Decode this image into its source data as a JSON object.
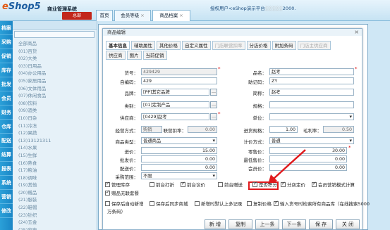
{
  "app": {
    "logo_prefix": "e",
    "logo_main": "Shop5",
    "subtitle": "商业管理系统",
    "hq_button": "总部",
    "auth_text": "授权用户<eShop演示平台",
    "auth_tail": "2000."
  },
  "top_tabs": [
    {
      "label": "首页"
    },
    {
      "label": "会员等级"
    },
    {
      "label": "商品档案"
    }
  ],
  "left_nav": [
    "档案",
    "采购",
    "促销",
    "库存",
    "批发",
    "会员",
    "财务",
    "仓库",
    "配送",
    "结算",
    "报表",
    "系统",
    "营销",
    "修改"
  ],
  "tree": {
    "items": [
      "全部商品",
      "(01)百货",
      "(02)大类",
      "(03)日用品",
      "(04)办公用品",
      "(05)家居用品",
      "(06)文体用品",
      "(07)休闲食品",
      "(08)饮料",
      "(09)酒类",
      "(10)日杂",
      "(11)冷冻",
      "(12)果蔬",
      "(13)13121311",
      "(14)水果",
      "(15)生鲜",
      "(16)熟食",
      "(17)粮油",
      "(18)调味",
      "(19)其他",
      "(20)赠品",
      "(21)服装",
      "(22)鞋帽",
      "(23)针织",
      "(24)五金",
      "(25)家电"
    ]
  },
  "dialog": {
    "title": "商品编辑",
    "tabs_row1": [
      {
        "label": "基本信息",
        "state": "active"
      },
      {
        "label": "辅助属性",
        "state": "normal"
      },
      {
        "label": "其他价格",
        "state": "normal"
      },
      {
        "label": "自定义属性",
        "state": "normal"
      },
      {
        "label": "门店联营扣率",
        "state": "disabled"
      },
      {
        "label": "分店价格",
        "state": "normal"
      },
      {
        "label": "附加条码",
        "state": "normal"
      },
      {
        "label": "门店主供应商",
        "state": "disabled"
      }
    ],
    "tabs_row2": [
      {
        "label": "供应商"
      },
      {
        "label": "图片"
      },
      {
        "label": "当前促销"
      }
    ],
    "fields": {
      "item_no": {
        "label": "货号：",
        "value": "429429"
      },
      "item_code": {
        "label": "自编码：",
        "value": "429"
      },
      "brand": {
        "label": "品牌：",
        "value": "[PP]其它品牌"
      },
      "category": {
        "label": "类别：",
        "value": "[01]定制产品"
      },
      "supplier": {
        "label": "供应商：",
        "value": "[0429]赵考"
      },
      "name": {
        "label": "品名：",
        "value": "赵考"
      },
      "mnemonic": {
        "label": "助记码：",
        "value": "ZY"
      },
      "short_name": {
        "label": "简称：",
        "value": "赵考"
      },
      "spec": {
        "label": "规格：",
        "value": ""
      },
      "unit": {
        "label": "单位：",
        "value": ""
      },
      "biz_mode": {
        "label": "经营方式：",
        "value": "购销"
      },
      "joint_rate": {
        "label": "联营扣率：",
        "value": "0.00"
      },
      "in_spec": {
        "label": "进货规格：",
        "value": "1.00"
      },
      "gross_rate": {
        "label": "毛利率：",
        "value": "0.50"
      },
      "item_type": {
        "label": "商品类型：",
        "value": "普通商品"
      },
      "price_type": {
        "label": "计价方式：",
        "value": "普通"
      },
      "purchase_price": {
        "label": "进价：",
        "value": "15.00"
      },
      "retail_price": {
        "label": "零售价：",
        "value": "30.00"
      },
      "wholesale_price": {
        "label": "批发价：",
        "value": "0.00"
      },
      "min_price": {
        "label": "最低售价：",
        "value": "0.00"
      },
      "dist_price": {
        "label": "配送价：",
        "value": "0.00"
      },
      "member_price": {
        "label": "会员价：",
        "value": "0.00"
      },
      "purchase_scope": {
        "label": "采购范围：",
        "value": "不限"
      }
    },
    "checks_row1": [
      {
        "label": "管理库存",
        "on": true
      },
      {
        "label": "前台打折",
        "on": false
      },
      {
        "label": "前台议价",
        "on": true
      },
      {
        "label": "前台赠送",
        "on": false
      },
      {
        "label": "是否积分",
        "on": true
      },
      {
        "label": "分店定价",
        "on": true
      },
      {
        "label": "会员营销模式计算",
        "on": true
      }
    ],
    "checks_row2": [
      {
        "label": "赠品无联套餐",
        "on": true
      }
    ],
    "checks_row3": [
      {
        "label": "保存后自动新增",
        "on": false
      },
      {
        "label": "保存后同步商城",
        "on": false
      },
      {
        "label": "新增时默认上多记录",
        "on": false
      },
      {
        "label": "复制价格",
        "on": false
      },
      {
        "label": "输入货号时检索所有商品库（在线搜索5000",
        "on": true
      }
    ],
    "check_tail": "万条码）",
    "buttons": {
      "new": "新 增",
      "copy": "复制",
      "prev": "上一条",
      "next": "下一条",
      "save": "保 存",
      "close": "关 闭"
    }
  }
}
